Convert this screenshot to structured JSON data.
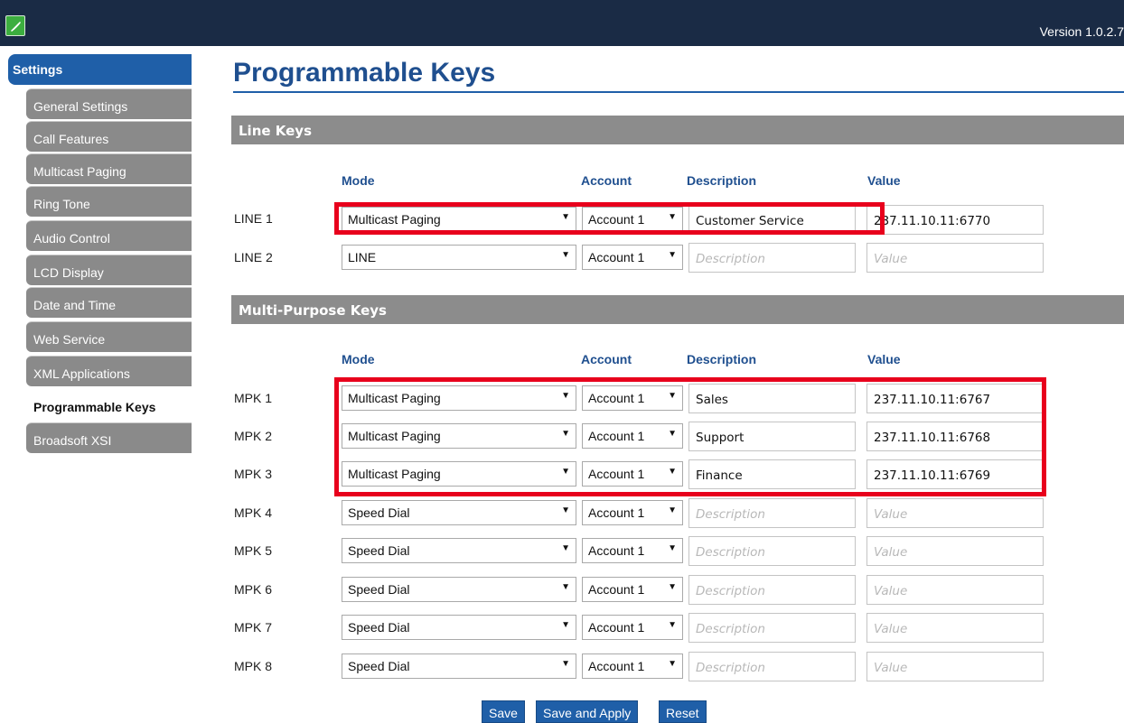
{
  "app": {
    "version": "Version 1.0.2.7",
    "logo_icon": "phone-icon"
  },
  "sidebar": {
    "header": "Settings",
    "items": [
      {
        "label": "General Settings"
      },
      {
        "label": "Call Features"
      },
      {
        "label": "Multicast Paging"
      },
      {
        "label": "Ring Tone"
      },
      {
        "label": "Audio Control"
      },
      {
        "label": "LCD Display"
      },
      {
        "label": "Date and Time"
      },
      {
        "label": "Web Service"
      },
      {
        "label": "XML Applications"
      },
      {
        "label": "Programmable Keys",
        "active": true
      },
      {
        "label": "Broadsoft XSI"
      }
    ]
  },
  "page": {
    "title": "Programmable Keys"
  },
  "columns": {
    "mode": "Mode",
    "account": "Account",
    "description": "Description",
    "value": "Value"
  },
  "line_keys": {
    "title": "Line Keys",
    "rows": [
      {
        "label": "LINE 1",
        "mode": "Multicast Paging",
        "account": "Account 1",
        "description": "Customer Service",
        "value": "237.11.10.11:6770"
      },
      {
        "label": "LINE 2",
        "mode": "LINE",
        "account": "Account 1",
        "description_placeholder": "Description",
        "value_placeholder": "Value"
      }
    ]
  },
  "mpk": {
    "title": "Multi-Purpose Keys",
    "rows": [
      {
        "label": "MPK 1",
        "mode": "Multicast Paging",
        "account": "Account 1",
        "description": "Sales",
        "value": "237.11.10.11:6767"
      },
      {
        "label": "MPK 2",
        "mode": "Multicast Paging",
        "account": "Account 1",
        "description": "Support",
        "value": "237.11.10.11:6768"
      },
      {
        "label": "MPK 3",
        "mode": "Multicast Paging",
        "account": "Account 1",
        "description": "Finance",
        "value": "237.11.10.11:6769"
      },
      {
        "label": "MPK 4",
        "mode": "Speed Dial",
        "account": "Account 1",
        "description_placeholder": "Description",
        "value_placeholder": "Value"
      },
      {
        "label": "MPK 5",
        "mode": "Speed Dial",
        "account": "Account 1",
        "description_placeholder": "Description",
        "value_placeholder": "Value"
      },
      {
        "label": "MPK 6",
        "mode": "Speed Dial",
        "account": "Account 1",
        "description_placeholder": "Description",
        "value_placeholder": "Value"
      },
      {
        "label": "MPK 7",
        "mode": "Speed Dial",
        "account": "Account 1",
        "description_placeholder": "Description",
        "value_placeholder": "Value"
      },
      {
        "label": "MPK 8",
        "mode": "Speed Dial",
        "account": "Account 1",
        "description_placeholder": "Description",
        "value_placeholder": "Value"
      }
    ]
  },
  "buttons": {
    "save": "Save",
    "save_apply": "Save and Apply",
    "reset": "Reset"
  },
  "colors": {
    "header_bg": "#1a2b45",
    "accent": "#1f5fa8",
    "highlight": "#e8001c",
    "sidebar_item": "#8a8a8a"
  }
}
